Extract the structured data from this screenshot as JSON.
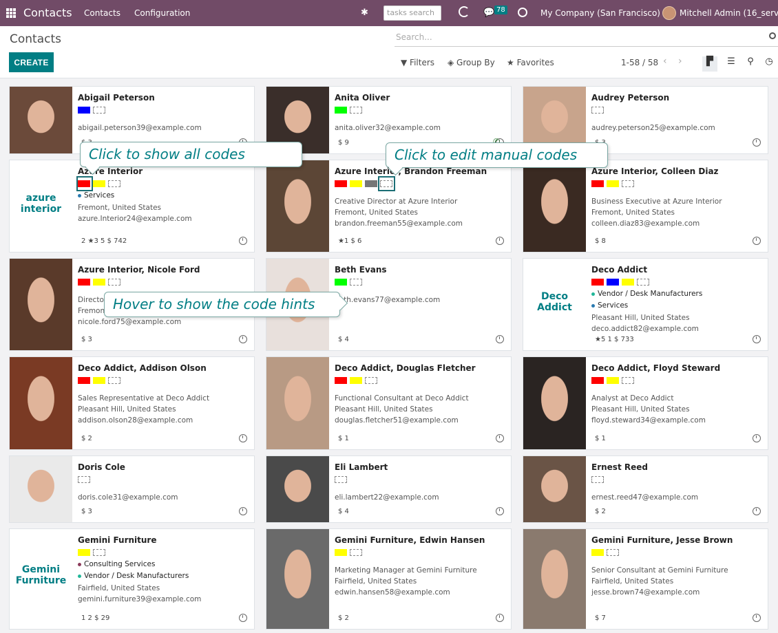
{
  "topbar": {
    "app_title": "Contacts",
    "menu": [
      "Contacts",
      "Configuration"
    ],
    "tasks_search_placeholder": "tasks search",
    "messages_count": "78",
    "company": "My Company (San Francisco)",
    "user": "Mitchell Admin (16_serve"
  },
  "control_panel": {
    "title": "Contacts",
    "create_label": "CREATE",
    "search_placeholder": "Search...",
    "filters": "Filters",
    "group_by": "Group By",
    "favorites": "Favorites",
    "pager": "1-58 / 58"
  },
  "colors": {
    "red": "#ff0000",
    "yellow": "#ffff00",
    "green": "#00ff00",
    "blue": "#0000ff",
    "gray": "#777777",
    "accent": "#017e84",
    "header": "#714b67"
  },
  "callouts": {
    "show_all": "Click to show all codes",
    "edit_manual": "Click to edit manual codes",
    "hover_hints": "Hover to show the code hints"
  },
  "cards": [
    {
      "name": "Abigail Peterson",
      "tags": [
        "blue",
        "empty"
      ],
      "lines": [
        "abigail.peterson39@example.com"
      ],
      "stats": "$ 3"
    },
    {
      "name": "Anita Oliver",
      "tags": [
        "green",
        "empty"
      ],
      "lines": [
        "anita.oliver32@example.com"
      ],
      "stats": "$ 9"
    },
    {
      "name": "Audrey Peterson",
      "tags": [
        "empty"
      ],
      "lines": [
        "audrey.peterson25@example.com"
      ],
      "stats": "$ 3"
    },
    {
      "name": "Azure Interior",
      "tags": [
        "red",
        "yellow",
        "empty"
      ],
      "category": "Services",
      "lines": [
        "Fremont, United States",
        "azure.Interior24@example.com"
      ],
      "stats": "2 ★3 5 $ 742",
      "logo": "azure interior"
    },
    {
      "name": "Azure Interior, Brandon Freeman",
      "tags": [
        "red",
        "yellow",
        "gray",
        "empty"
      ],
      "lines": [
        "Creative Director at Azure Interior",
        "Fremont, United States",
        "brandon.freeman55@example.com"
      ],
      "stats": "★1 $ 6"
    },
    {
      "name": "Azure Interior, Colleen Diaz",
      "tags": [
        "red",
        "yellow",
        "empty"
      ],
      "lines": [
        "Business Executive at Azure Interior",
        "Fremont, United States",
        "colleen.diaz83@example.com"
      ],
      "stats": "$ 8"
    },
    {
      "name": "Azure Interior, Nicole Ford",
      "tags": [
        "red",
        "yellow",
        "empty"
      ],
      "lines": [
        "Director",
        "Fremont",
        "nicole.ford75@example.com"
      ],
      "stats": "$ 3"
    },
    {
      "name": "Beth Evans",
      "tags": [
        "green",
        "empty"
      ],
      "lines": [
        "beth.evans77@example.com"
      ],
      "stats": "$ 4"
    },
    {
      "name": "Deco Addict",
      "tags": [
        "red",
        "blue",
        "yellow",
        "empty"
      ],
      "category": "Vendor / Desk Manufacturers",
      "category2": "Services",
      "lines": [
        "Pleasant Hill, United States",
        "deco.addict82@example.com"
      ],
      "stats": "★5 1 $ 733",
      "logo": "Deco Addict"
    },
    {
      "name": "Deco Addict, Addison Olson",
      "tags": [
        "red",
        "yellow",
        "empty"
      ],
      "lines": [
        "Sales Representative at Deco Addict",
        "Pleasant Hill, United States",
        "addison.olson28@example.com"
      ],
      "stats": "$ 2"
    },
    {
      "name": "Deco Addict, Douglas Fletcher",
      "tags": [
        "red",
        "yellow",
        "empty"
      ],
      "lines": [
        "Functional Consultant at Deco Addict",
        "Pleasant Hill, United States",
        "douglas.fletcher51@example.com"
      ],
      "stats": "$ 1"
    },
    {
      "name": "Deco Addict, Floyd Steward",
      "tags": [
        "red",
        "yellow",
        "empty"
      ],
      "lines": [
        "Analyst at Deco Addict",
        "Pleasant Hill, United States",
        "floyd.steward34@example.com"
      ],
      "stats": "$ 1"
    },
    {
      "name": "Doris Cole",
      "tags": [
        "empty"
      ],
      "lines": [
        "doris.cole31@example.com"
      ],
      "stats": "$ 3"
    },
    {
      "name": "Eli Lambert",
      "tags": [
        "empty"
      ],
      "lines": [
        "eli.lambert22@example.com"
      ],
      "stats": "$ 4"
    },
    {
      "name": "Ernest Reed",
      "tags": [
        "empty"
      ],
      "lines": [
        "ernest.reed47@example.com"
      ],
      "stats": "$ 2"
    },
    {
      "name": "Gemini Furniture",
      "tags": [
        "yellow",
        "empty"
      ],
      "category": "Consulting Services",
      "category2": "Vendor / Desk Manufacturers",
      "lines": [
        "Fairfield, United States",
        "gemini.furniture39@example.com"
      ],
      "stats": "1 2 $ 29",
      "logo": "Gemini Furniture"
    },
    {
      "name": "Gemini Furniture, Edwin Hansen",
      "tags": [
        "yellow",
        "empty"
      ],
      "lines": [
        "Marketing Manager at Gemini Furniture",
        "Fairfield, United States",
        "edwin.hansen58@example.com"
      ],
      "stats": "$ 2"
    },
    {
      "name": "Gemini Furniture, Jesse Brown",
      "tags": [
        "yellow",
        "empty"
      ],
      "lines": [
        "Senior Consultant at Gemini Furniture",
        "Fairfield, United States",
        "jesse.brown74@example.com"
      ],
      "stats": "$ 7"
    }
  ]
}
